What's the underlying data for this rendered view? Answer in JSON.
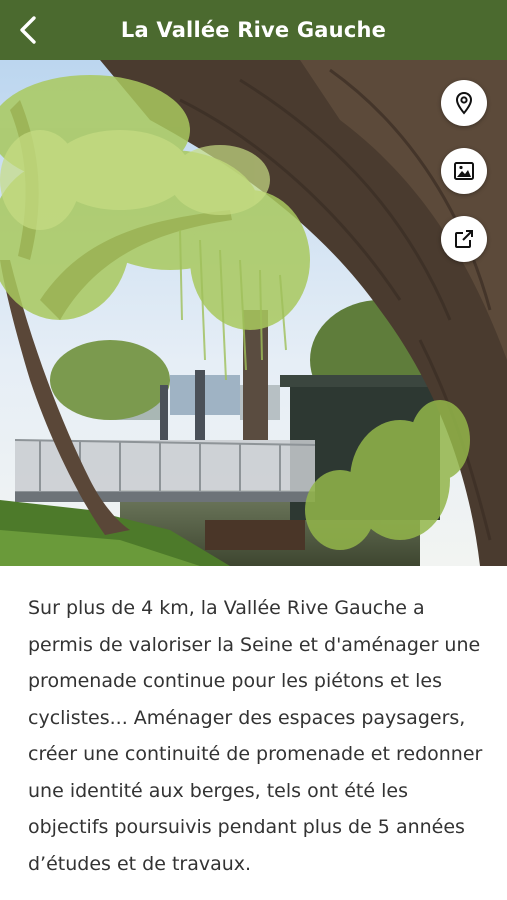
{
  "header": {
    "title": "La Vallée Rive Gauche",
    "back_icon": "chevron-left-icon",
    "background": "#4b6a2f"
  },
  "hero": {
    "image": "riverside park photo with willow tree and footbridge",
    "actions": [
      {
        "name": "map-pin-icon"
      },
      {
        "name": "gallery-icon"
      },
      {
        "name": "external-link-icon"
      }
    ]
  },
  "body": {
    "text": "Sur plus de 4 km, la Vallée Rive Gauche a permis de valoriser la Seine et d'aménager une promenade continue pour les piétons et les cyclistes... Aménager des espaces paysagers, créer une continuité de promenade et redonner une identité aux berges, tels ont été les objectifs poursuivis pendant plus de 5 années d’études et de travaux."
  }
}
